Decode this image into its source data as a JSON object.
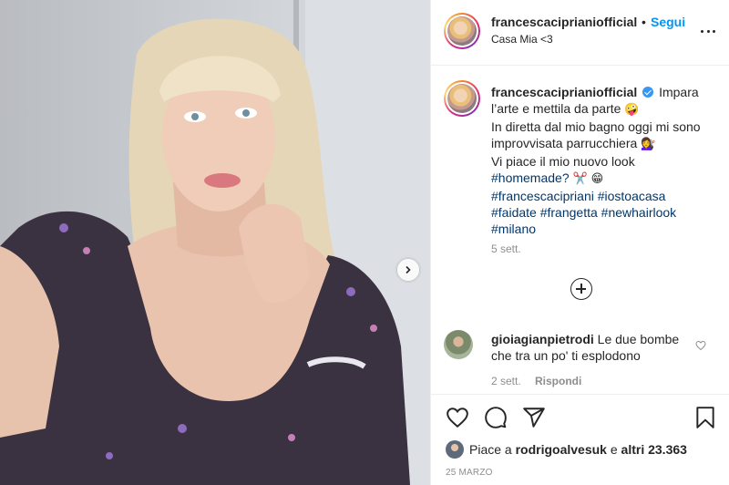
{
  "post": {
    "username": "francescaciprianiofficial",
    "dot": "•",
    "follow_label": "Segui",
    "location": "Casa Mia <3"
  },
  "caption": {
    "username": "francescaciprianiofficial",
    "line1": "Impara l’arte e mettila da parte",
    "emoji1": "🤪",
    "line2": "In diretta dal mio bagno oggi mi sono improvvisata parrucchiera",
    "emoji2": "💇‍♀️",
    "line3": "Vi piace il mio nuovo look",
    "tag_homemade": "#homemade?",
    "emoji3": "✂️",
    "emoji4": "😁",
    "tags": [
      "#francescacipriani",
      "#iostoacasa",
      "#faidate",
      "#frangetta",
      "#newhairlook",
      "#milano"
    ],
    "time": "5 sett."
  },
  "comment": {
    "username": "gioiagianpietrodi",
    "text": "Le due bombe che tra un po' ti esplodono",
    "time": "2 sett.",
    "reply_label": "Rispondi"
  },
  "likes": {
    "prefix": "Piace a",
    "user": "rodrigoalvesuk",
    "middle": "e",
    "others": "altri 23.363"
  },
  "date": "25 MARZO",
  "icons": {
    "next": "chevron-right-icon",
    "more": "more-horizontal-icon",
    "load_more": "plus-circle-icon",
    "like": "heart-icon",
    "comment": "comment-icon",
    "share": "send-icon",
    "save": "bookmark-icon",
    "verified": "verified-badge-icon"
  },
  "colors": {
    "link": "#0095f6",
    "hashtag": "#00376b",
    "muted": "#8e8e8e",
    "text": "#262626",
    "verified": "#3897f0"
  }
}
